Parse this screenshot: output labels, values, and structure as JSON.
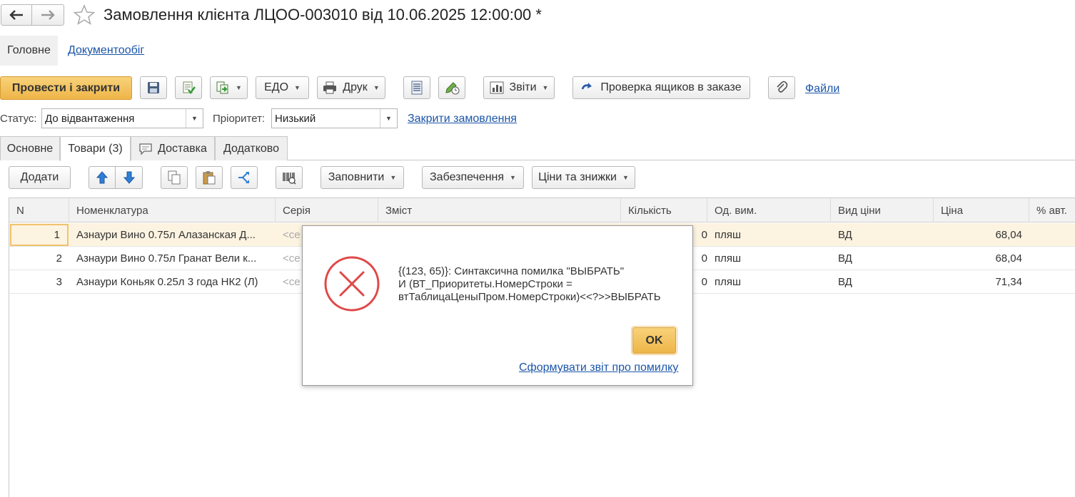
{
  "window": {
    "title": "Замовлення клієнта ЛЦОО-003010 від 10.06.2025 12:00:00 *"
  },
  "nav": {
    "main_tab": "Головне",
    "docflow_link": "Документообіг"
  },
  "toolbar": {
    "post_close": "Провести і закрити",
    "edo": "ЕДО",
    "print": "Друк",
    "reports": "Звіти",
    "check_boxes": "Проверка ящиков в заказе",
    "files": "Файли"
  },
  "status": {
    "label": "Статус:",
    "value": "До відвантаження",
    "priority_label": "Пріоритет:",
    "priority_value": "Низький",
    "close_order_link": "Закрити замовлення"
  },
  "tabs": [
    {
      "label": "Основне"
    },
    {
      "label": "Товари (3)"
    },
    {
      "label": "Доставка"
    },
    {
      "label": "Додатково"
    }
  ],
  "table_toolbar": {
    "add": "Додати",
    "fill": "Заповнити",
    "supply": "Забезпечення",
    "prices": "Ціни та знижки"
  },
  "table": {
    "columns": [
      "N",
      "Номенклатура",
      "Серія",
      "Зміст",
      "Кількість",
      "Од. вим.",
      "Вид ціни",
      "Ціна",
      "% авт."
    ],
    "rows": [
      {
        "n": "1",
        "item": "Азнаури Вино 0.75л Алазанская Д...",
        "series": "<се",
        "qty": "0",
        "unit": "пляш",
        "price_type": "ВД",
        "price": "68,04"
      },
      {
        "n": "2",
        "item": "Азнаури Вино 0.75л Гранат Вели к...",
        "series": "<се",
        "qty": "0",
        "unit": "пляш",
        "price_type": "ВД",
        "price": "68,04"
      },
      {
        "n": "3",
        "item": "Азнаури Коньяк 0.25л 3 года НК2 (Л)",
        "series": "<се",
        "qty": "0",
        "unit": "пляш",
        "price_type": "ВД",
        "price": "71,34"
      }
    ]
  },
  "dialog": {
    "line1": "{(123, 65)}: Синтаксична помилка \"ВЫБРАТЬ\"",
    "line2": "И (ВТ_Приоритеты.НомерСтроки =",
    "line3": "втТаблицаЦеныПром.НомерСтроки)<<?>>ВЫБРАТЬ",
    "ok": "OK",
    "report_link": "Сформувати звіт про помилку"
  },
  "colors": {
    "accent": "#f3c154",
    "error": "#e04848",
    "link": "#1a55a8",
    "selected_row": "#fdf3e1"
  }
}
